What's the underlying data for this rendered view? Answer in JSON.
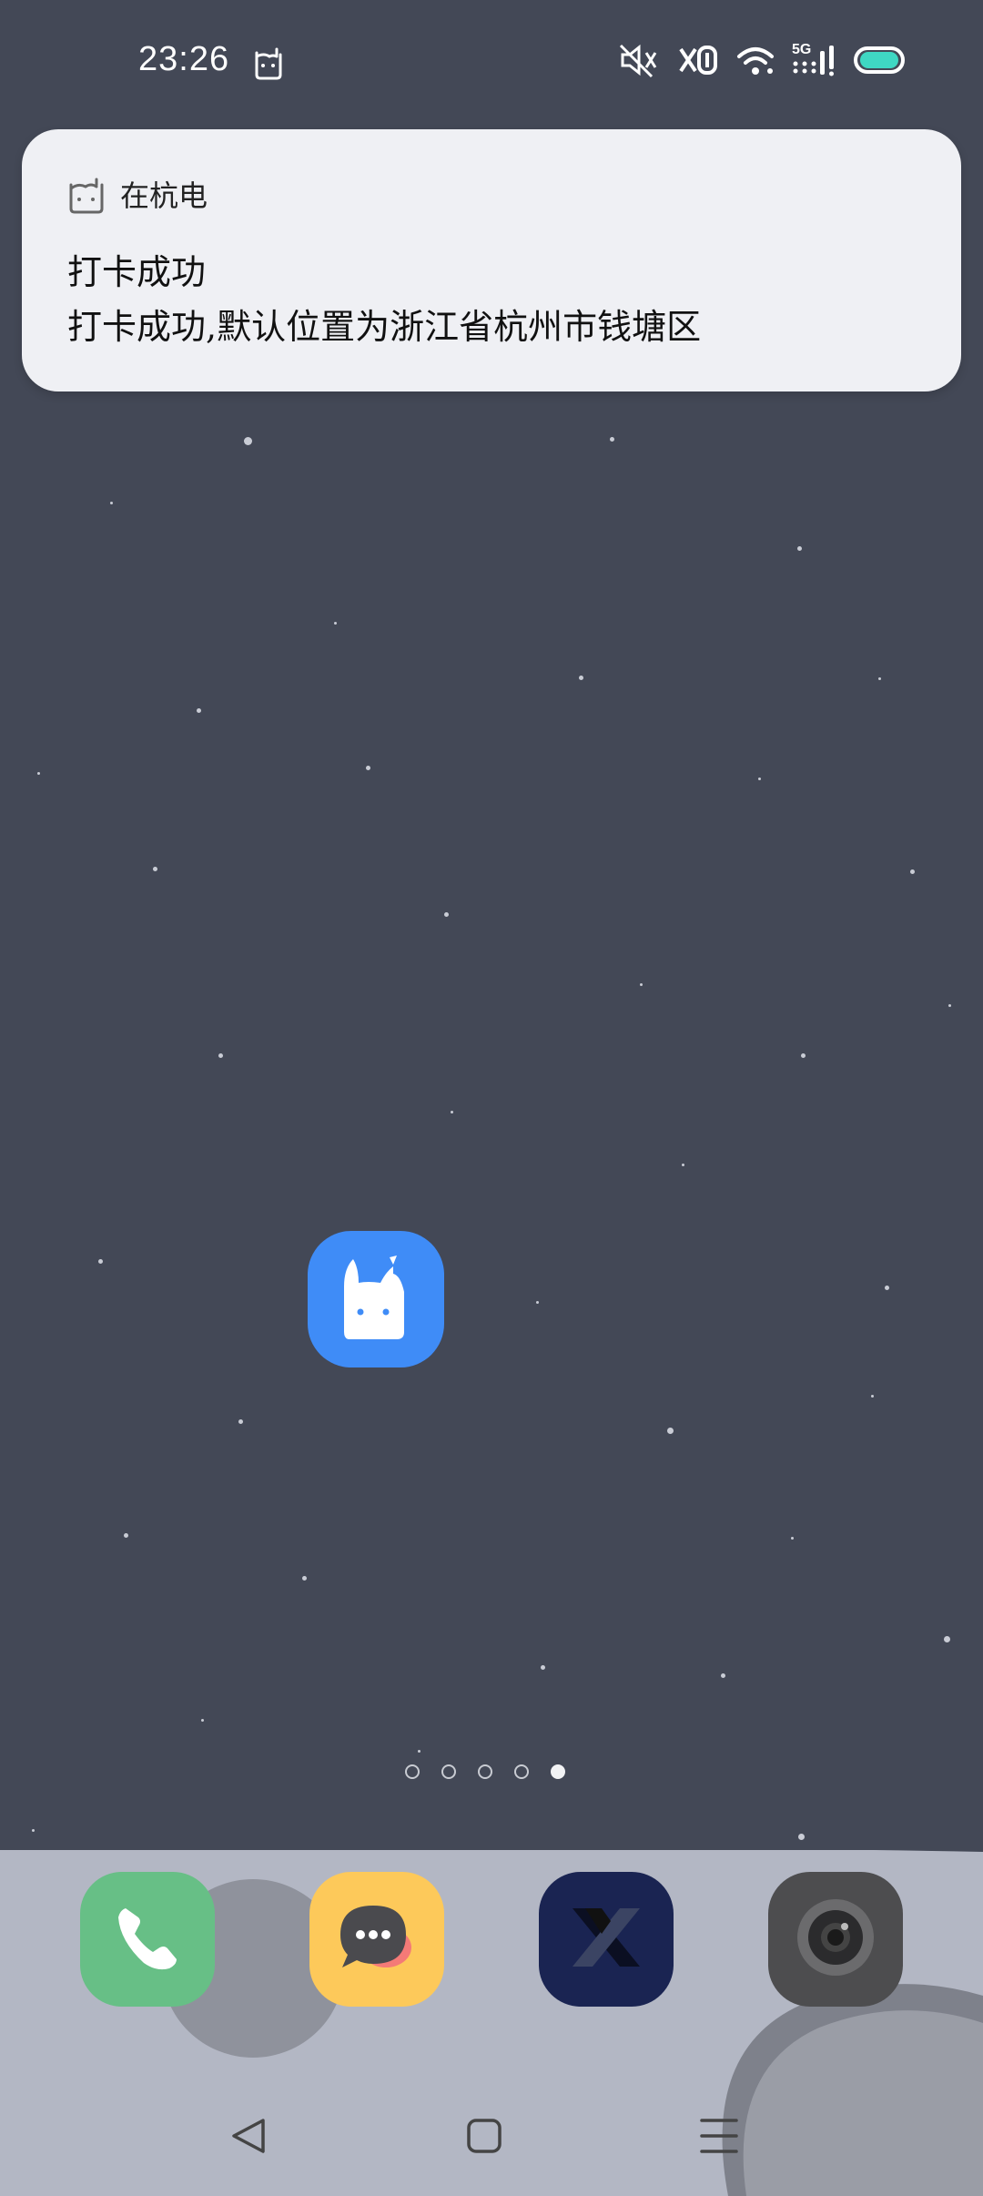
{
  "status_bar": {
    "time": "23:26",
    "icons": [
      "rabbit-app-icon",
      "mute-icon",
      "vibrate-icon",
      "wifi-icon",
      "signal-5g-icon",
      "battery-icon"
    ],
    "network_label": "5G"
  },
  "notification": {
    "app_name": "在杭电",
    "app_icon": "rabbit-outline-icon",
    "title": "打卡成功",
    "body": "打卡成功,默认位置为浙江省杭州市钱塘区"
  },
  "home": {
    "app_icon": "rabbit-app-icon",
    "app_color": "#3f8cf7"
  },
  "pager": {
    "pages": 5,
    "active_index": 4
  },
  "dock": {
    "apps": [
      {
        "icon": "phone-icon",
        "color": "#67bf86"
      },
      {
        "icon": "messages-icon",
        "color": "#fdc95a"
      },
      {
        "icon": "x-app-icon",
        "color": "#1a2452"
      },
      {
        "icon": "camera-icon",
        "color": "#4d4d4f"
      }
    ]
  },
  "nav": {
    "buttons": [
      "back-icon",
      "home-icon",
      "menu-icon"
    ]
  }
}
